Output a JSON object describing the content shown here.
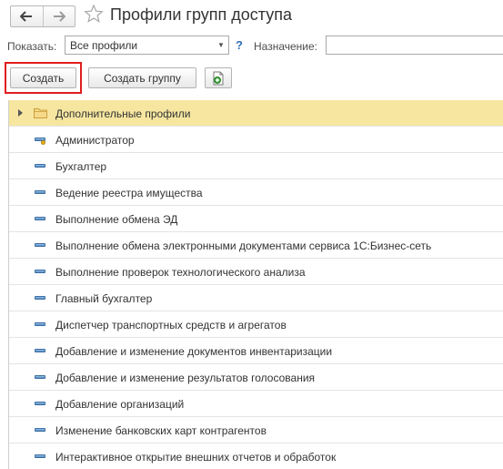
{
  "header": {
    "title": "Профили групп доступа",
    "back_icon": "arrow-left-icon",
    "forward_icon": "arrow-right-icon",
    "favorite_icon": "star-icon"
  },
  "filter": {
    "show_label": "Показать:",
    "show_value": "Все профили",
    "help_label": "?",
    "purpose_label": "Назначение:",
    "purpose_value": ""
  },
  "toolbar": {
    "create_label": "Создать",
    "create_group_label": "Создать группу",
    "copy_icon": "copy-document-icon",
    "highlight_color": "#e01d1d"
  },
  "list": {
    "items": [
      {
        "label": "Дополнительные профили",
        "icon": "folder-icon",
        "expandable": true,
        "selected": true
      },
      {
        "label": "Администратор",
        "icon": "admin-profile-icon"
      },
      {
        "label": "Бухгалтер",
        "icon": "profile-icon"
      },
      {
        "label": "Ведение реестра имущества",
        "icon": "profile-icon"
      },
      {
        "label": "Выполнение обмена ЭД",
        "icon": "profile-icon"
      },
      {
        "label": "Выполнение обмена электронными документами сервиса 1С:Бизнес-сеть",
        "icon": "profile-icon"
      },
      {
        "label": "Выполнение проверок технологического анализа",
        "icon": "profile-icon"
      },
      {
        "label": "Главный бухгалтер",
        "icon": "profile-icon"
      },
      {
        "label": "Диспетчер транспортных средств и агрегатов",
        "icon": "profile-icon"
      },
      {
        "label": "Добавление и изменение документов инвентаризации",
        "icon": "profile-icon"
      },
      {
        "label": "Добавление и изменение результатов голосования",
        "icon": "profile-icon"
      },
      {
        "label": "Добавление организаций",
        "icon": "profile-icon"
      },
      {
        "label": "Изменение банковских карт контрагентов",
        "icon": "profile-icon"
      },
      {
        "label": "Интерактивное открытие внешних отчетов и обработок",
        "icon": "profile-icon"
      }
    ]
  },
  "colors": {
    "selected_row": "#f6e6a0",
    "accent_blue": "#2f6fb5"
  }
}
